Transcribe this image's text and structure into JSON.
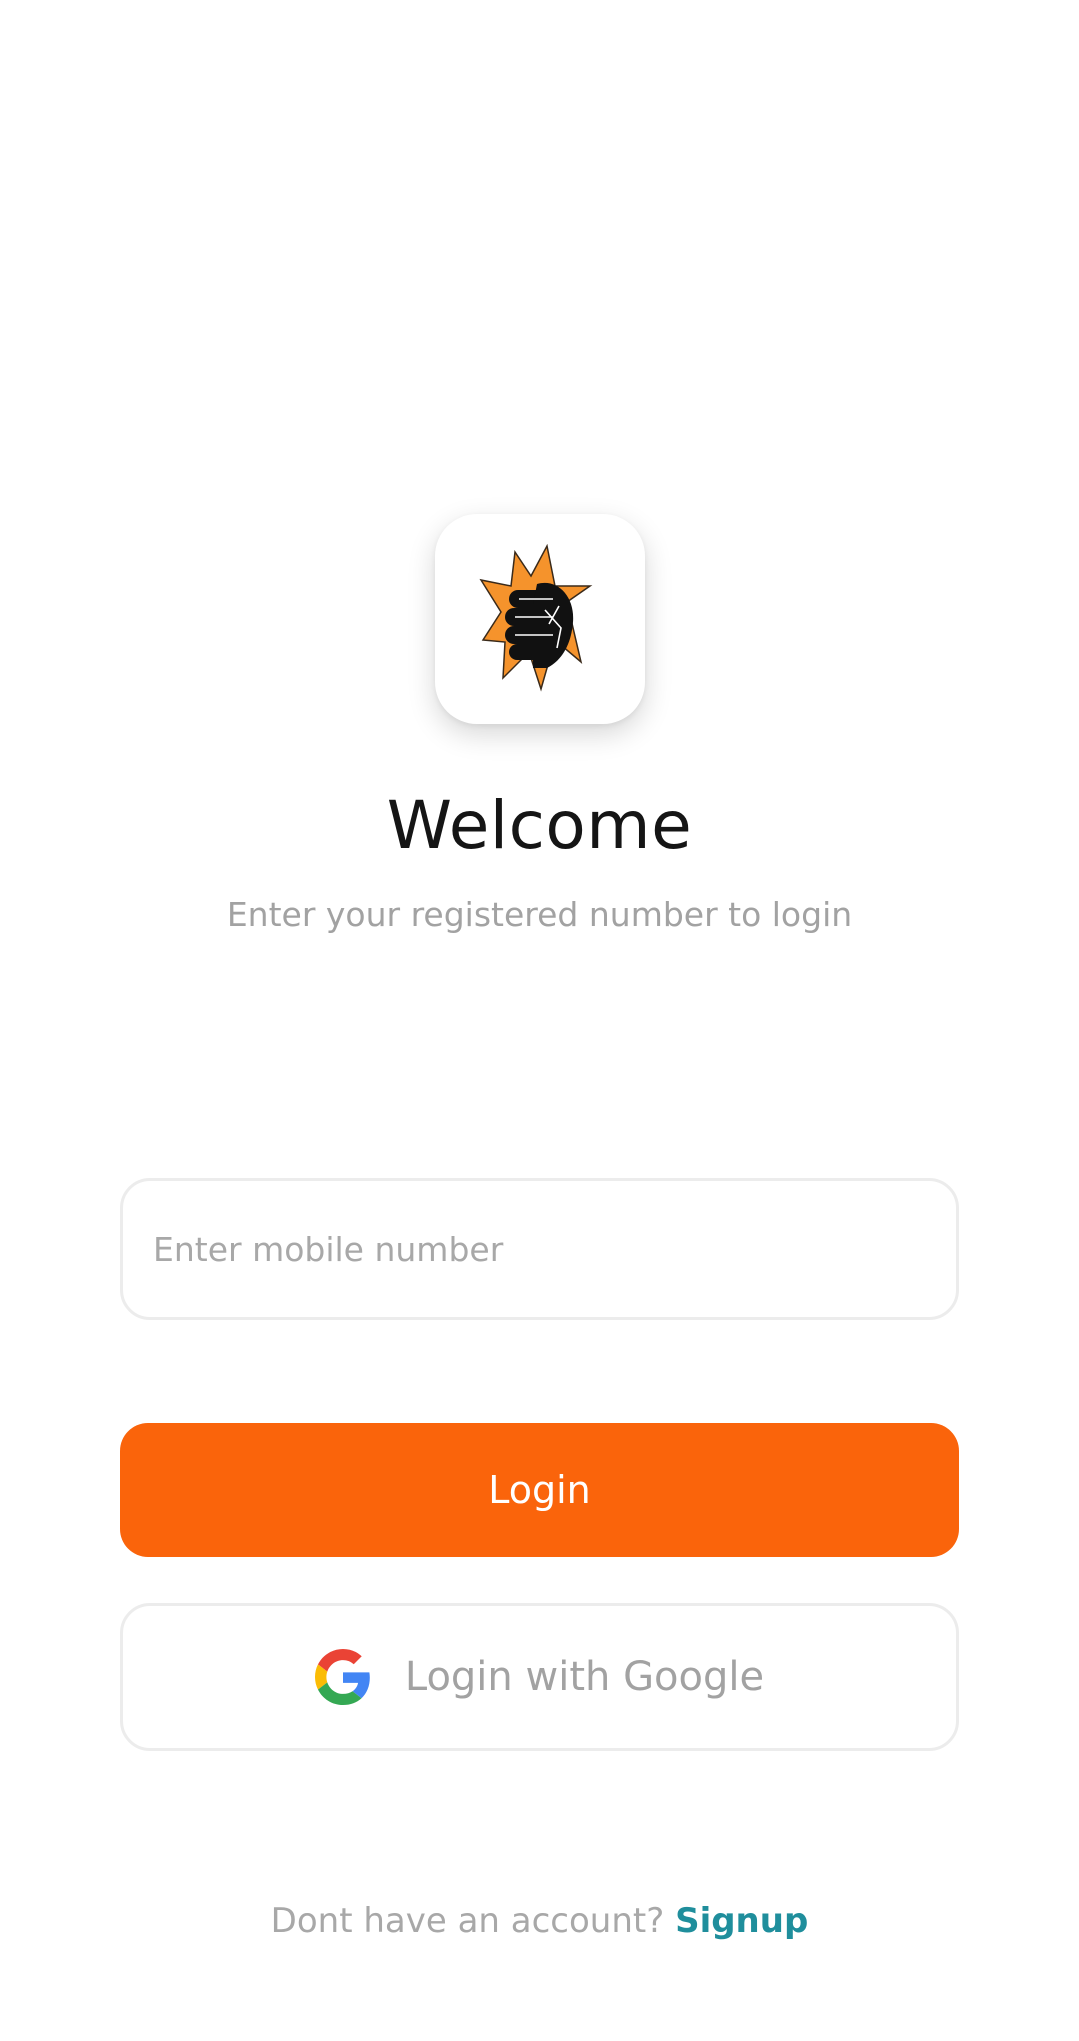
{
  "app": {
    "logo_icon": "raised-fist-burst-icon",
    "accent_color": "#fa640b",
    "link_color": "#1f8e9c"
  },
  "header": {
    "title": "Welcome",
    "subtitle": "Enter your registered number to login"
  },
  "form": {
    "mobile_placeholder": "Enter mobile number",
    "mobile_value": "",
    "login_label": "Login",
    "google_label": "Login with Google",
    "google_icon": "google-g-icon"
  },
  "footer": {
    "prompt": "Dont have an account?",
    "signup_label": "Signup"
  }
}
